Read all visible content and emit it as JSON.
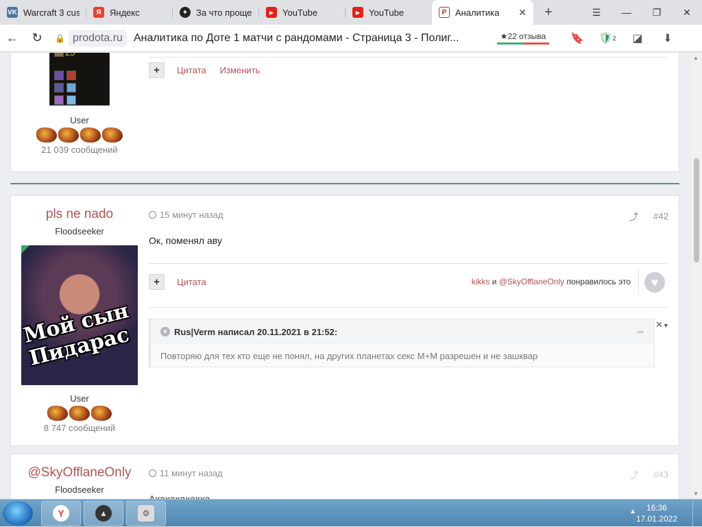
{
  "tabs": [
    {
      "title": "Warcraft 3 cus",
      "icon": "vk-icon",
      "color": "#4c75a3",
      "glyph": "VK"
    },
    {
      "title": "Яндекс",
      "icon": "yandex-icon",
      "color": "#e8412c",
      "glyph": "Я"
    },
    {
      "title": "За что проще",
      "icon": "compass-icon",
      "color": "#222222",
      "glyph": "✦"
    },
    {
      "title": "YouTube",
      "icon": "youtube-icon",
      "color": "#e62117",
      "glyph": "▶"
    },
    {
      "title": "YouTube",
      "icon": "youtube-icon",
      "color": "#e62117",
      "glyph": "▶"
    },
    {
      "title": "Аналитика",
      "icon": "prodota-icon",
      "color": "#b22c2c",
      "glyph": "P"
    }
  ],
  "address": {
    "domain": "prodota.ru",
    "page_title": "Аналитика по Доте 1 матчи с рандомами - Страница 3 - Полиг...",
    "reviews": "22 отзыва",
    "protect_count": "2"
  },
  "top_post": {
    "inventory_number": "25",
    "role": "User",
    "posts": "21 039 сообщений",
    "action_quote": "Цитата",
    "action_edit": "Изменить"
  },
  "post42": {
    "author": "pls ne nado",
    "group": "Floodseeker",
    "avatar_caption": "Мой сын Пидарас",
    "role": "User",
    "posts": "8 747 сообщений",
    "time": "15 минут назад",
    "number": "#42",
    "body": "Ок, поменял аву",
    "action_quote": "Цитата",
    "likers_a": "kikks",
    "likers_and": "и",
    "likers_b": "@SkyOfflaneOnly",
    "likers_tail": "понравилось это",
    "quote_header": "Rus|Verm написал 20.11.2021 в 21:52:",
    "quote_body": "Повторяю для тех кто еще не понял, на других планетах секс М+М разрешен и не зашквар"
  },
  "post43": {
    "author": "@SkyOfflaneOnly",
    "group": "Floodseeker",
    "time": "11 минут назад",
    "number": "#43",
    "body": "Ахахахахахха"
  },
  "taskbar": {
    "time": "16:36",
    "date": "17.01.2022"
  }
}
